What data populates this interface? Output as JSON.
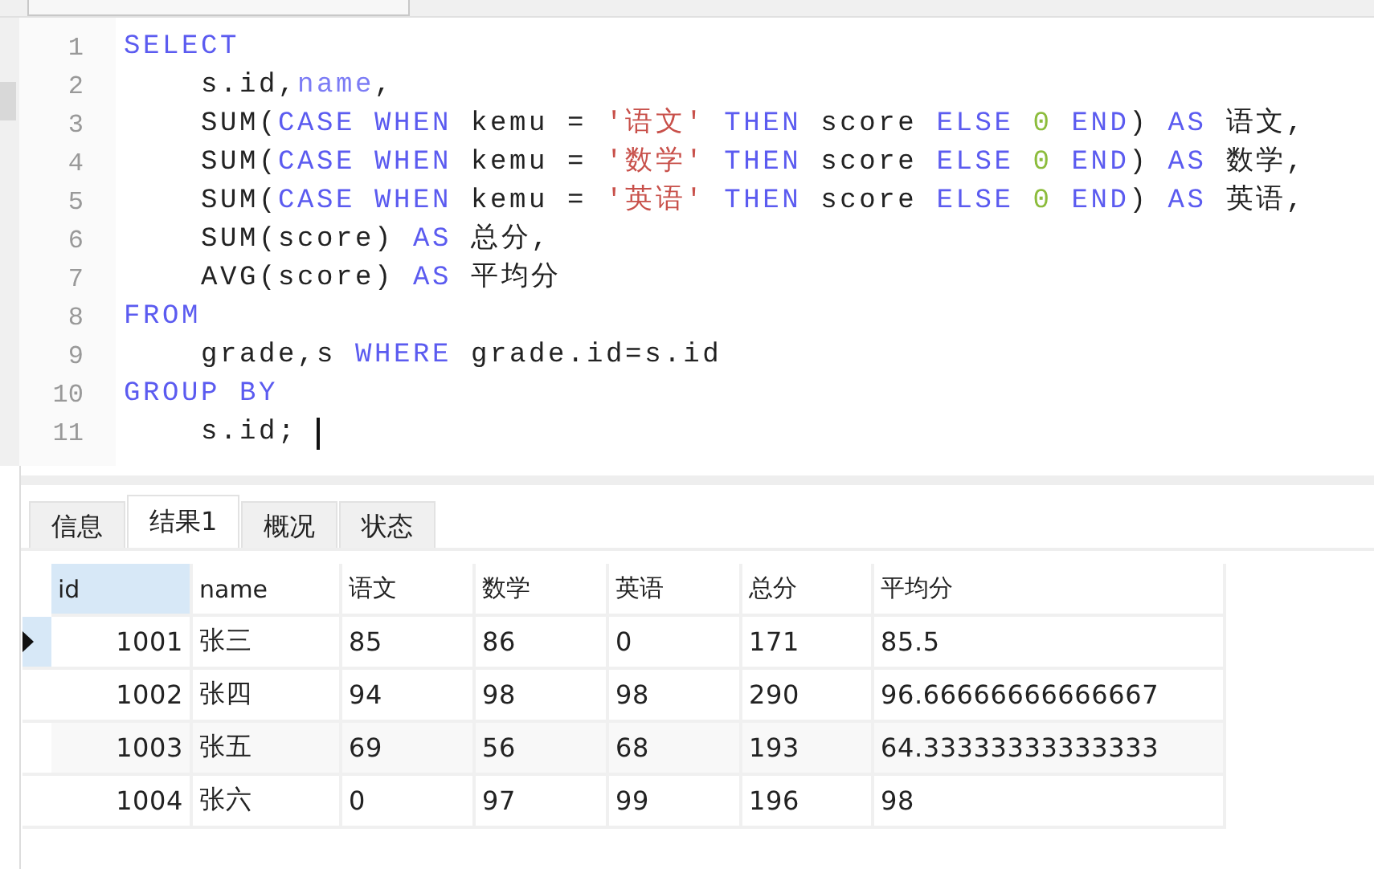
{
  "editor": {
    "lines": [
      {
        "number": "1",
        "tokens": [
          {
            "kind": "keyword",
            "text": "SELECT"
          }
        ]
      },
      {
        "number": "2",
        "tokens": [
          {
            "kind": "plain",
            "text": "    s.id,"
          },
          {
            "kind": "field",
            "text": "name"
          },
          {
            "kind": "plain",
            "text": ","
          }
        ]
      },
      {
        "number": "3",
        "tokens": [
          {
            "kind": "plain",
            "text": "    SUM("
          },
          {
            "kind": "keyword",
            "text": "CASE WHEN"
          },
          {
            "kind": "plain",
            "text": " kemu = "
          },
          {
            "kind": "string",
            "text": "'语文'"
          },
          {
            "kind": "keyword",
            "text": " THEN"
          },
          {
            "kind": "plain",
            "text": " score "
          },
          {
            "kind": "keyword",
            "text": "ELSE"
          },
          {
            "kind": "number",
            "text": " 0"
          },
          {
            "kind": "keyword",
            "text": " END"
          },
          {
            "kind": "plain",
            "text": ") "
          },
          {
            "kind": "keyword",
            "text": "AS"
          },
          {
            "kind": "plain",
            "text": " 语文,"
          }
        ]
      },
      {
        "number": "4",
        "tokens": [
          {
            "kind": "plain",
            "text": "    SUM("
          },
          {
            "kind": "keyword",
            "text": "CASE WHEN"
          },
          {
            "kind": "plain",
            "text": " kemu = "
          },
          {
            "kind": "string",
            "text": "'数学'"
          },
          {
            "kind": "keyword",
            "text": " THEN"
          },
          {
            "kind": "plain",
            "text": " score "
          },
          {
            "kind": "keyword",
            "text": "ELSE"
          },
          {
            "kind": "number",
            "text": " 0"
          },
          {
            "kind": "keyword",
            "text": " END"
          },
          {
            "kind": "plain",
            "text": ") "
          },
          {
            "kind": "keyword",
            "text": "AS"
          },
          {
            "kind": "plain",
            "text": " 数学,"
          }
        ]
      },
      {
        "number": "5",
        "tokens": [
          {
            "kind": "plain",
            "text": "    SUM("
          },
          {
            "kind": "keyword",
            "text": "CASE WHEN"
          },
          {
            "kind": "plain",
            "text": " kemu = "
          },
          {
            "kind": "string",
            "text": "'英语'"
          },
          {
            "kind": "keyword",
            "text": " THEN"
          },
          {
            "kind": "plain",
            "text": " score "
          },
          {
            "kind": "keyword",
            "text": "ELSE"
          },
          {
            "kind": "number",
            "text": " 0"
          },
          {
            "kind": "keyword",
            "text": " END"
          },
          {
            "kind": "plain",
            "text": ") "
          },
          {
            "kind": "keyword",
            "text": "AS"
          },
          {
            "kind": "plain",
            "text": " 英语,"
          }
        ]
      },
      {
        "number": "6",
        "tokens": [
          {
            "kind": "plain",
            "text": "    SUM(score) "
          },
          {
            "kind": "keyword",
            "text": "AS"
          },
          {
            "kind": "plain",
            "text": " 总分,"
          }
        ]
      },
      {
        "number": "7",
        "tokens": [
          {
            "kind": "plain",
            "text": "    AVG(score) "
          },
          {
            "kind": "keyword",
            "text": "AS"
          },
          {
            "kind": "plain",
            "text": " 平均分"
          }
        ]
      },
      {
        "number": "8",
        "tokens": [
          {
            "kind": "keyword",
            "text": "FROM"
          }
        ]
      },
      {
        "number": "9",
        "tokens": [
          {
            "kind": "plain",
            "text": "    grade,s "
          },
          {
            "kind": "keyword",
            "text": "WHERE"
          },
          {
            "kind": "plain",
            "text": " grade.id=s.id"
          }
        ]
      },
      {
        "number": "10",
        "tokens": [
          {
            "kind": "keyword",
            "text": "GROUP BY"
          }
        ]
      },
      {
        "number": "11",
        "tokens": [
          {
            "kind": "plain",
            "text": "    s.id; "
          }
        ],
        "cursor": true
      }
    ]
  },
  "result_tabs": [
    {
      "label": "信息",
      "selected": false
    },
    {
      "label": "结果1",
      "selected": true
    },
    {
      "label": "概况",
      "selected": false
    },
    {
      "label": "状态",
      "selected": false
    }
  ],
  "table": {
    "columns": [
      {
        "label": "id",
        "kind": "integer",
        "selected": true
      },
      {
        "label": "name",
        "kind": "text",
        "selected": false
      },
      {
        "label": "语文",
        "kind": "text",
        "selected": false
      },
      {
        "label": "数学",
        "kind": "text",
        "selected": false
      },
      {
        "label": "英语",
        "kind": "text",
        "selected": false
      },
      {
        "label": "总分",
        "kind": "text",
        "selected": false
      },
      {
        "label": "平均分",
        "kind": "text",
        "selected": false
      }
    ],
    "rows": [
      {
        "selected": true,
        "cells": [
          "1001",
          "张三",
          "85",
          "86",
          "0",
          "171",
          "85.5"
        ]
      },
      {
        "selected": false,
        "cells": [
          "1002",
          "张四",
          "94",
          "98",
          "98",
          "290",
          "96.66666666666667"
        ]
      },
      {
        "selected": false,
        "cells": [
          "1003",
          "张五",
          "69",
          "56",
          "68",
          "193",
          "64.33333333333333"
        ]
      },
      {
        "selected": false,
        "cells": [
          "1004",
          "张六",
          "0",
          "97",
          "99",
          "196",
          "98"
        ]
      }
    ]
  }
}
